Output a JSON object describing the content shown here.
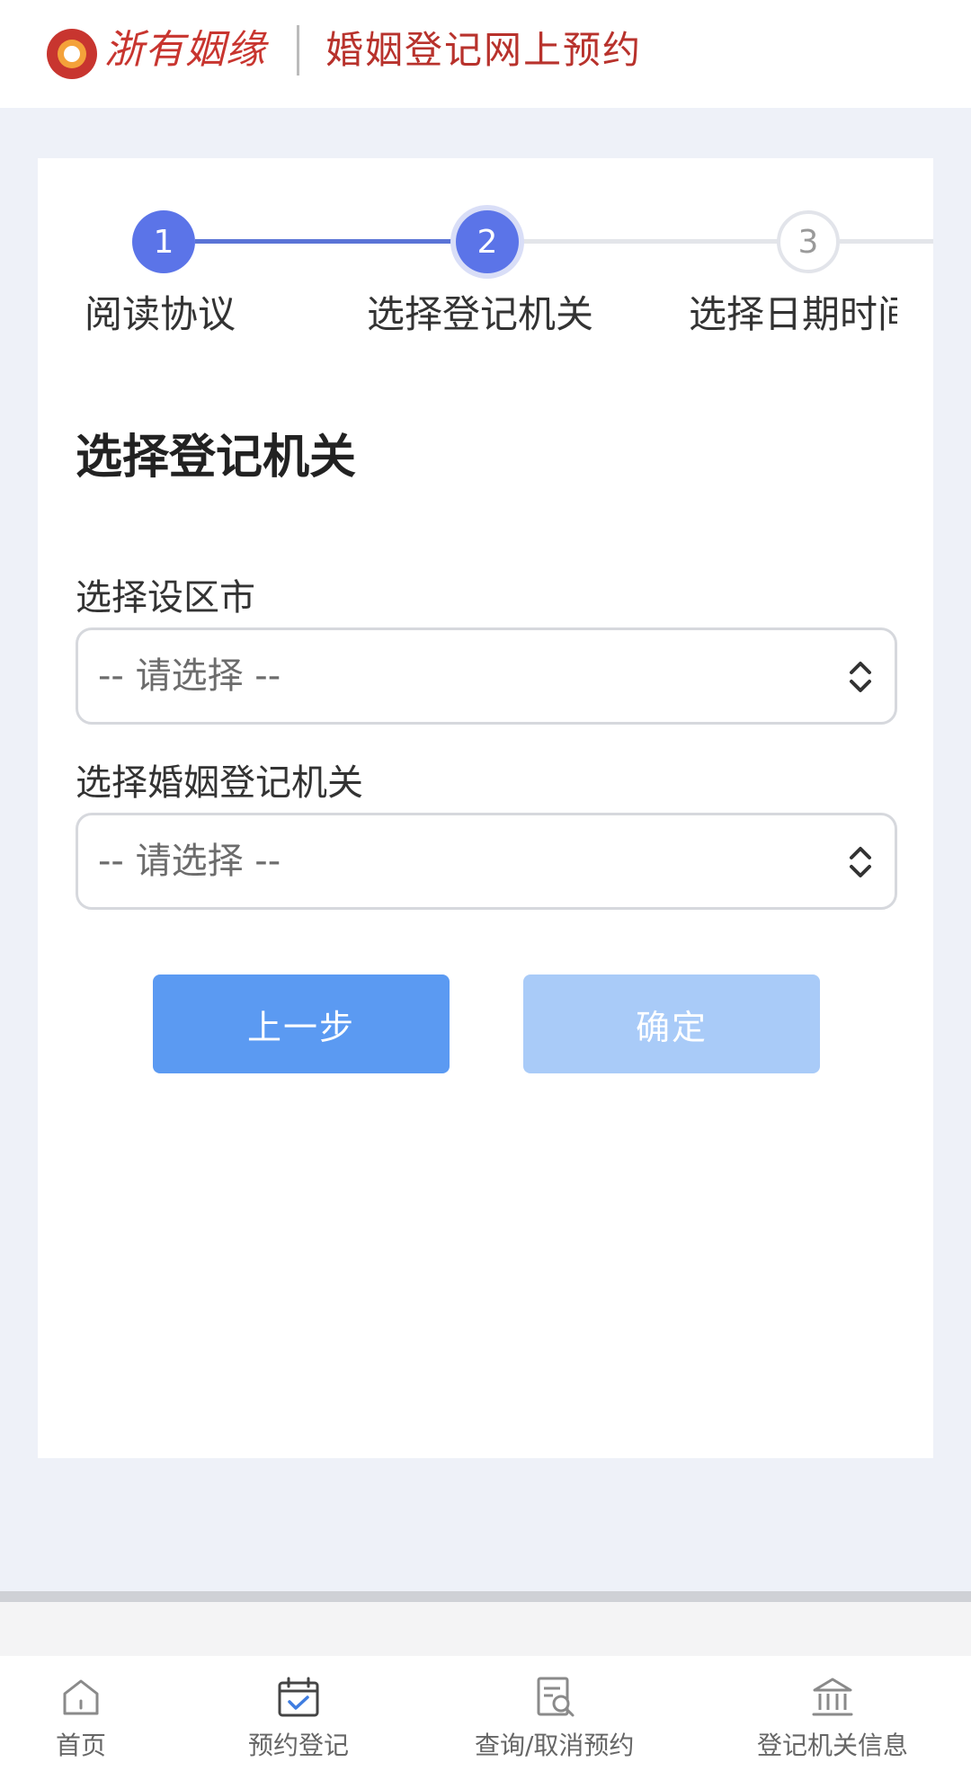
{
  "header": {
    "logo_text": "浙有姻缘",
    "title": "婚姻登记网上预约"
  },
  "stepper": {
    "steps": [
      {
        "number": "1",
        "label": "阅读协议",
        "state": "done"
      },
      {
        "number": "2",
        "label": "选择登记机关",
        "state": "active"
      },
      {
        "number": "3",
        "label": "选择日期时间",
        "state": "todo"
      }
    ]
  },
  "form": {
    "section_title": "选择登记机关",
    "city_label": "选择设区市",
    "city_value": "-- 请选择 --",
    "office_label": "选择婚姻登记机关",
    "office_value": "-- 请选择 --"
  },
  "buttons": {
    "prev_label": "上一步",
    "confirm_label": "确定"
  },
  "tabbar": {
    "items": [
      {
        "label": "首页",
        "icon": "home-icon"
      },
      {
        "label": "预约登记",
        "icon": "calendar-check-icon"
      },
      {
        "label": "查询/取消预约",
        "icon": "search-document-icon"
      },
      {
        "label": "登记机关信息",
        "icon": "building-icon"
      }
    ]
  },
  "colors": {
    "brand_red": "#c8352f",
    "step_active": "#5b74e8",
    "button_primary": "#5b9af2",
    "button_disabled": "#a9cbf8"
  }
}
